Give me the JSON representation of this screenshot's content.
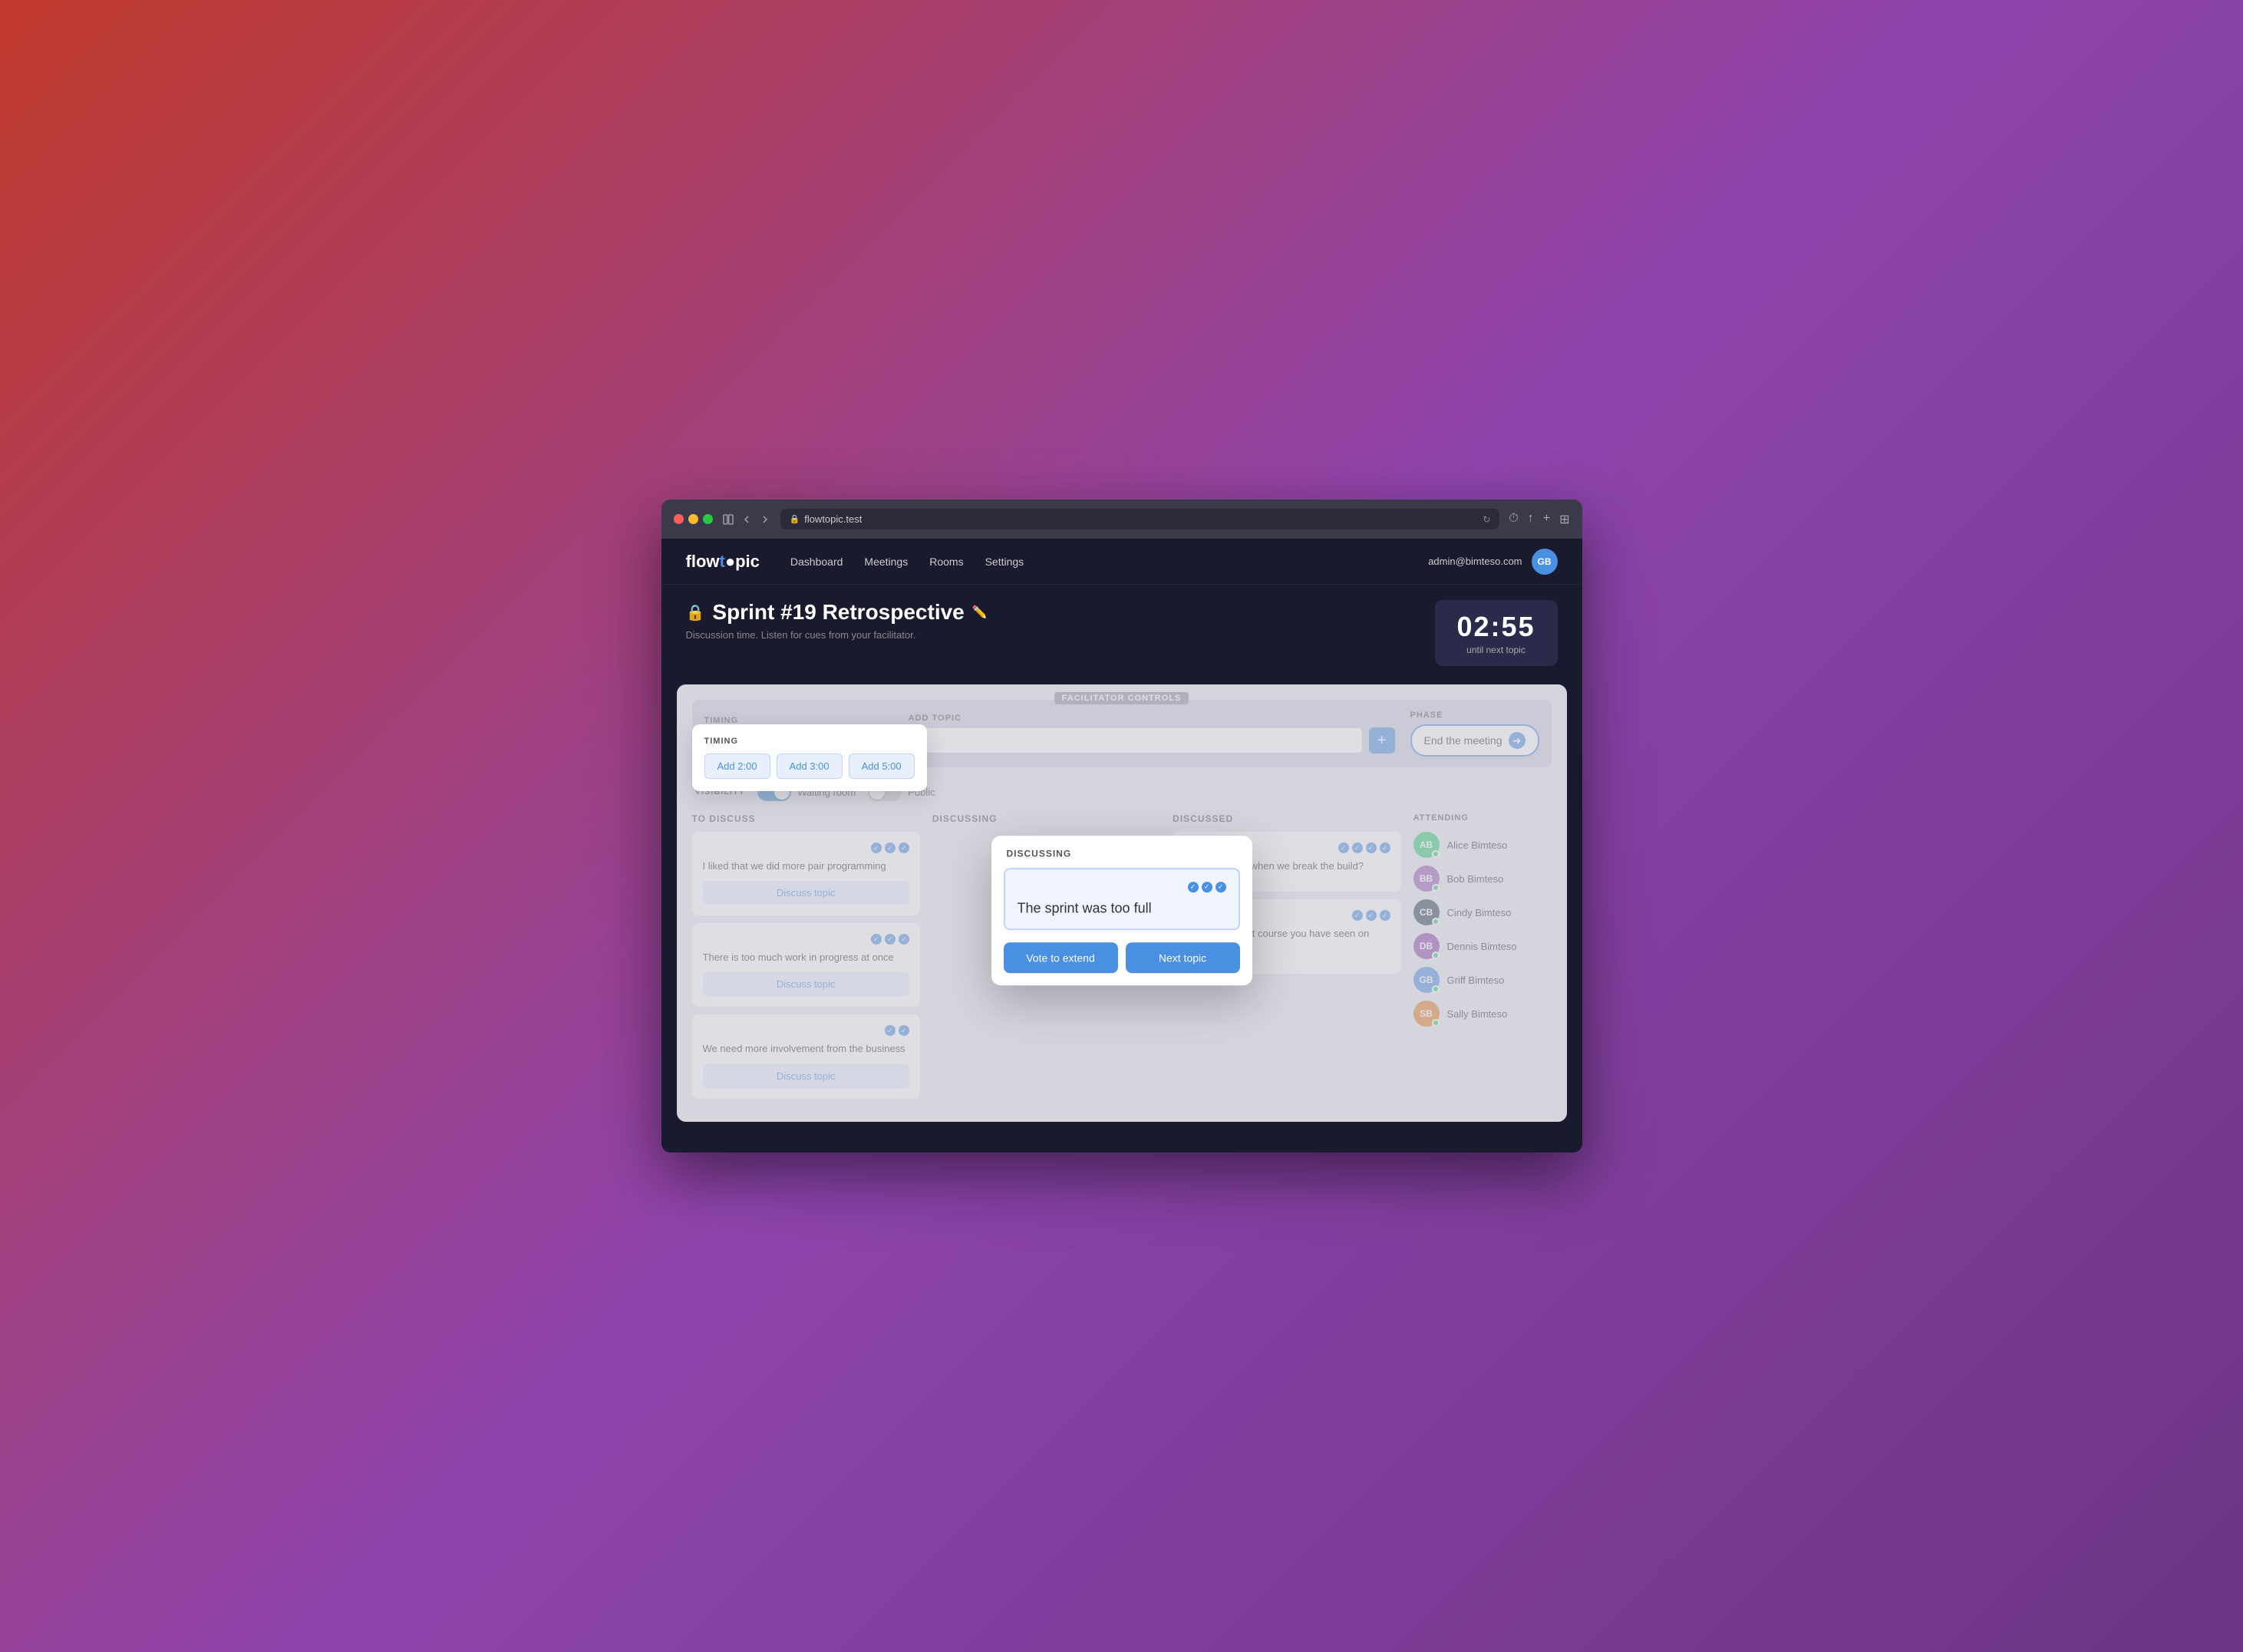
{
  "browser": {
    "url": "flowtopic.test"
  },
  "nav": {
    "logo": "flowtopic",
    "logo_dot": "●",
    "links": [
      "Dashboard",
      "Meetings",
      "Rooms",
      "Settings"
    ],
    "user_email": "admin@bimteso.com",
    "user_initials": "GB"
  },
  "page": {
    "title": "Sprint #19 Retrospective",
    "subtitle": "Discussion time. Listen for cues from your facilitator.",
    "timer": "02:55",
    "timer_label": "until next topic"
  },
  "facilitator": {
    "label": "FACILITATOR CONTROLS",
    "timing_label": "TIMING",
    "add_topic_label": "ADD TOPIC",
    "phase_label": "PHASE",
    "timing_buttons": [
      "Add 2:00",
      "Add 3:00",
      "Add 5:00"
    ],
    "end_meeting": "End the meeting"
  },
  "visibility": {
    "label": "VISIBILITY",
    "waiting_room": "Waiting room",
    "public": "Public"
  },
  "columns": {
    "to_discuss": {
      "header": "TO DISCUSS",
      "items": [
        {
          "text": "I liked that we did more pair programming",
          "votes": 3,
          "action": "Discuss topic"
        },
        {
          "text": "There is too much work in progress at once",
          "votes": 3,
          "action": "Discuss topic"
        },
        {
          "text": "We need more involvement from the business",
          "votes": 2,
          "action": "Discuss topic"
        }
      ]
    },
    "discussing": {
      "header": "DISCUSSING",
      "topic": "The sprint was too full",
      "votes": 3,
      "vote_extend": "Vote to extend",
      "next_topic": "Next topic"
    },
    "discussed": {
      "header": "DISCUSSED",
      "items": [
        {
          "text": "What happens when we break the build?",
          "votes": 4
        },
        {
          "text": "What is the best course you have seen on TDD?",
          "votes": 3
        }
      ]
    }
  },
  "attending": {
    "label": "ATTENDING",
    "attendees": [
      {
        "name": "Alice Bimteso",
        "initials": "AB",
        "color": "#2ecc71"
      },
      {
        "name": "Bob Bimteso",
        "initials": "BB",
        "color": "#9b59b6"
      },
      {
        "name": "Cindy Bimteso",
        "initials": "CB",
        "color": "#1a1a2e"
      },
      {
        "name": "Dennis Bimteso",
        "initials": "DB",
        "color": "#8e44ad"
      },
      {
        "name": "Griff Bimteso",
        "initials": "GB",
        "color": "#4a90e2"
      },
      {
        "name": "Sally Bimteso",
        "initials": "SB",
        "color": "#e67e22"
      }
    ]
  }
}
